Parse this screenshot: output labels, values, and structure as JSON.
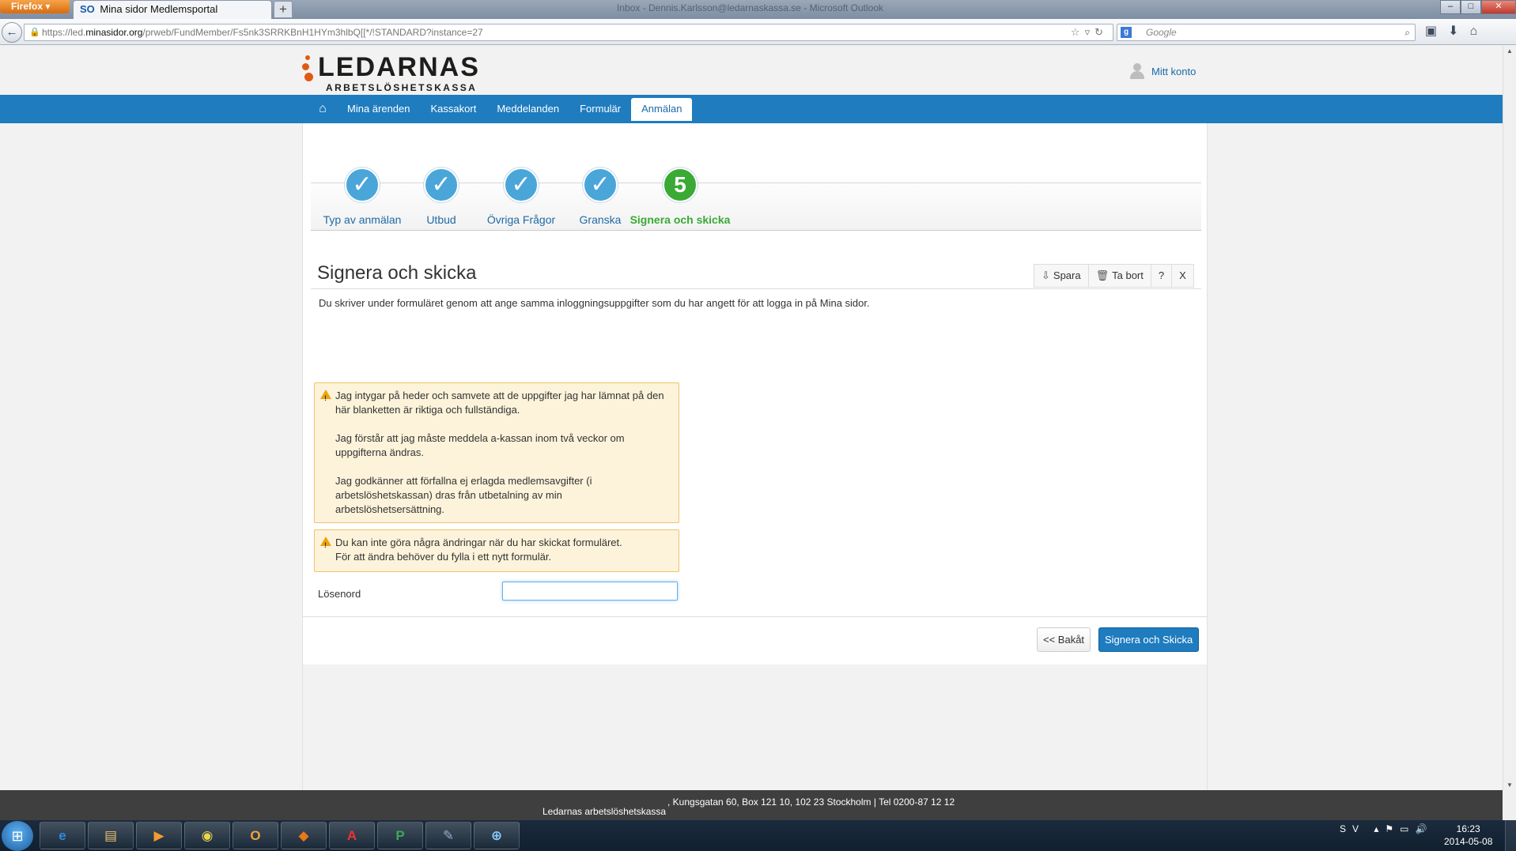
{
  "browser": {
    "menu_label": "Firefox",
    "tab_title": "Mina sidor Medlemsportal",
    "tab_favicon": "SO",
    "new_tab": "+",
    "window_title": "Inbox - Dennis.Karlsson@ledarnaskassa.se - Microsoft Outlook",
    "url_prefix": "https://led.",
    "url_host": "minasidor.org",
    "url_path": "/prweb/FundMember/Fs5nk3SRRKBnH1HYm3hlbQ[[*/!STANDARD?instance=27",
    "search_engine_icon": "g",
    "search_placeholder": "Google",
    "window_controls": {
      "minimize": "–",
      "maximize": "□",
      "close": "✕"
    }
  },
  "header": {
    "logo_name": "LEDARNAS",
    "logo_sub": "ARBETSLÖSHETSKASSA",
    "account_label": "Mitt konto"
  },
  "nav": {
    "home_icon": "⌂",
    "items": [
      "Mina ärenden",
      "Kassakort",
      "Meddelanden",
      "Formulär",
      "Anmälan"
    ],
    "active": "Anmälan"
  },
  "steps": [
    {
      "label": "Typ av anmälan",
      "mark": "✓",
      "state": "done"
    },
    {
      "label": "Utbud",
      "mark": "✓",
      "state": "done"
    },
    {
      "label": "Övriga Frågor",
      "mark": "✓",
      "state": "done"
    },
    {
      "label": "Granska",
      "mark": "✓",
      "state": "done"
    },
    {
      "label": "Signera och skicka",
      "mark": "5",
      "state": "current"
    }
  ],
  "form": {
    "title": "Signera och skicka",
    "actions": {
      "save": "Spara",
      "delete": "Ta bort",
      "help": "?",
      "close": "X"
    },
    "intro": "Du skriver under formuläret genom att ange samma inloggningsuppgifter som du har angett för att logga in på Mina sidor.",
    "warning1": [
      "Jag intygar på heder och samvete att de uppgifter jag har lämnat på den här blanketten är riktiga och fullständiga.",
      "Jag förstår att jag måste meddela a-kassan inom två veckor om uppgifterna ändras.",
      "Jag godkänner att förfallna ej erlagda medlemsavgifter (i arbetslöshetskassan) dras från utbetalning av min arbetslöshetsersättning."
    ],
    "warning2": [
      "Du kan inte göra några ändringar när du har skickat formuläret.",
      "För att ändra behöver du fylla i ett nytt formulär."
    ],
    "password_label": "Lösenord",
    "password_value": "",
    "back_button": "<< Bakåt",
    "submit_button": "Signera och Skicka"
  },
  "footer": {
    "org": "Ledarnas arbetslöshetskassa",
    "address": ", Kungsgatan 60, Box 121 10, 102 23 Stockholm | Tel 0200-87 12 12"
  },
  "taskbar": {
    "apps": [
      "e",
      "▤",
      "▶",
      "◉",
      "O",
      "◆",
      "A",
      "P",
      "✎",
      "⊕"
    ],
    "language": "SV",
    "time": "16:23",
    "date": "2014-05-08"
  },
  "colors": {
    "brand_blue": "#1e7cbf",
    "step_done": "#4aa6d8",
    "step_current": "#3aaa35",
    "logo_orange": "#e05a13",
    "warning_bg": "#fcf3da"
  }
}
